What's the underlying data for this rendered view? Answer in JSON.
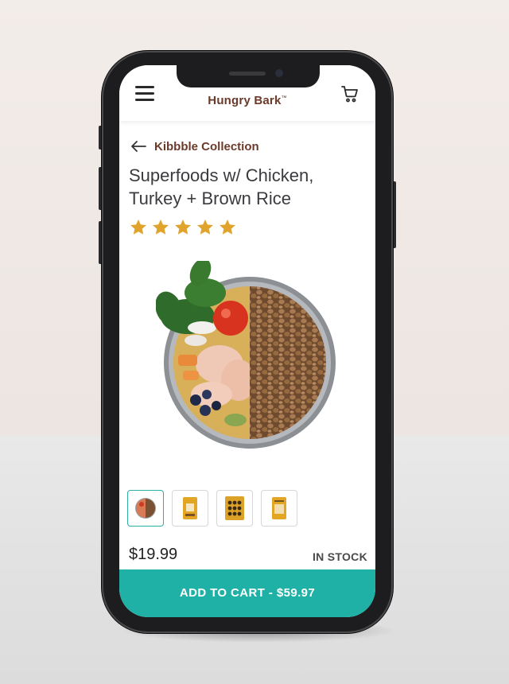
{
  "header": {
    "brand": "Hungry Bark",
    "brand_mark": "™",
    "menu_icon": "hamburger-menu-icon",
    "cart_icon": "shopping-cart-icon"
  },
  "breadcrumb": {
    "back_icon": "arrow-left-icon",
    "label": "Kibbble Collection"
  },
  "product": {
    "title_line1": "Superfoods w/ Chicken,",
    "title_line2": "Turkey + Brown Rice",
    "rating": 5,
    "rating_max": 5,
    "price": "$19.99",
    "stock_status": "IN STOCK",
    "thumbnails": [
      "food-bowl-thumbnail",
      "bag-front-thumbnail",
      "nutrition-panel-thumbnail",
      "bag-back-thumbnail"
    ],
    "selected_thumbnail": 0
  },
  "cta": {
    "label": "ADD TO CART - $59.97"
  },
  "colors": {
    "brand": "#6b3a2a",
    "accent": "#1fb0a6",
    "star": "#e0a32c"
  }
}
